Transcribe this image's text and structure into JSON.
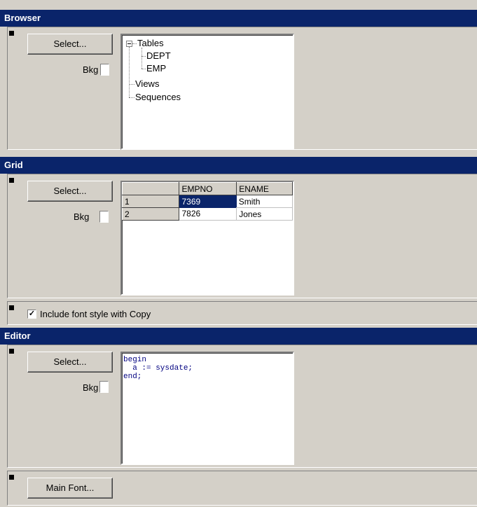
{
  "browser": {
    "title": "Browser",
    "select_label": "Select...",
    "bkg_label": "Bkg",
    "tree": {
      "tables": "Tables",
      "dept": "DEPT",
      "emp": "EMP",
      "views": "Views",
      "sequences": "Sequences"
    }
  },
  "grid": {
    "title": "Grid",
    "select_label": "Select...",
    "bkg_label": "Bkg",
    "columns": [
      "",
      "EMPNO",
      "ENAME"
    ],
    "rows": [
      {
        "num": "1",
        "empno": "7369",
        "ename": "Smith"
      },
      {
        "num": "2",
        "empno": "7826",
        "ename": "Jones"
      }
    ],
    "selected_cell": "row1-empno"
  },
  "copy_option": {
    "label": "Include font style with Copy",
    "checked": true,
    "check_glyph": "✓"
  },
  "editor": {
    "title": "Editor",
    "select_label": "Select...",
    "bkg_label": "Bkg",
    "code_lines": [
      "begin",
      "  a := sysdate;",
      "end;"
    ]
  },
  "main_font": {
    "label": "Main Font..."
  },
  "colors": {
    "header_bg": "#0a246a",
    "panel_bg": "#d4d0c8",
    "code_color": "#000080"
  }
}
